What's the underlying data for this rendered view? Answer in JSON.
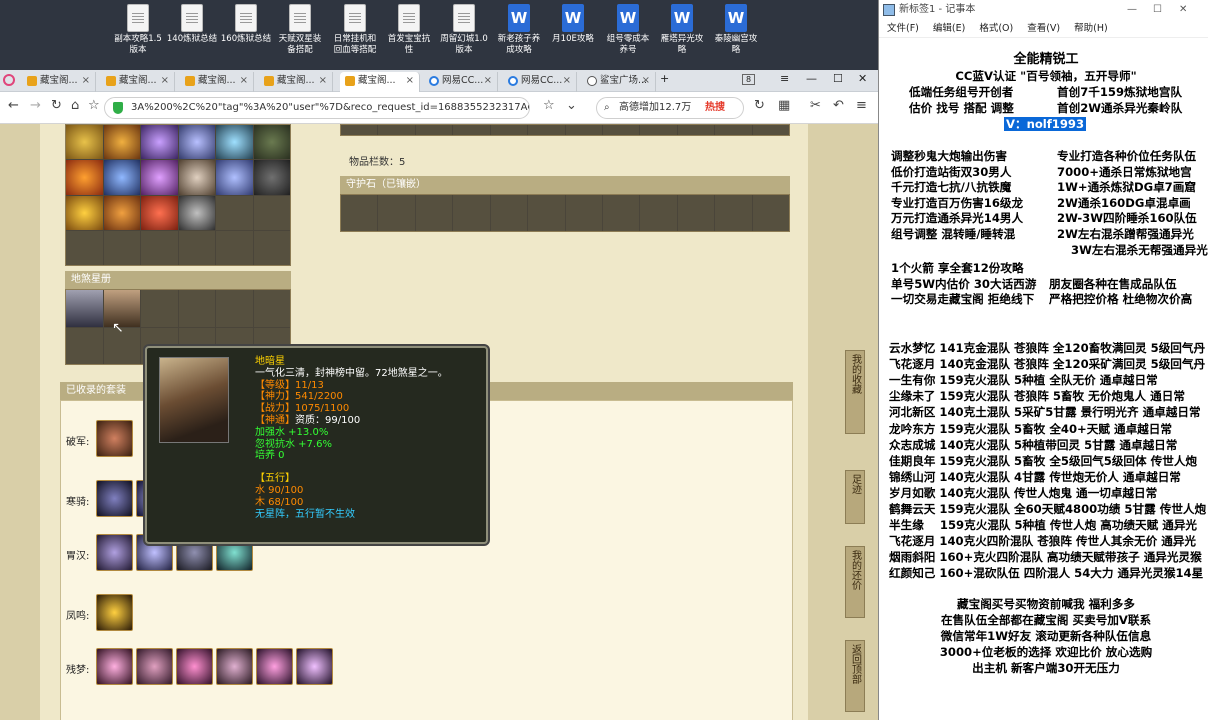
{
  "desktop_icons": [
    {
      "label": "副本攻略1.5\n版本",
      "type": "txt"
    },
    {
      "label": "140炼狱总结",
      "type": "txt"
    },
    {
      "label": "160炼狱总结",
      "type": "txt"
    },
    {
      "label": "天赋双星装\n备搭配",
      "type": "txt"
    },
    {
      "label": "日常挂机和\n回血等搭配",
      "type": "txt"
    },
    {
      "label": "首发宝宝抗\n性",
      "type": "txt"
    },
    {
      "label": "周留幻城1.0\n版本",
      "type": "txt"
    },
    {
      "label": "新老孩子养\n成攻略",
      "type": "word"
    },
    {
      "label": "月10E攻略",
      "type": "word"
    },
    {
      "label": "组号零成本\n养号",
      "type": "word"
    },
    {
      "label": "雁塔异光攻\n略",
      "type": "word"
    },
    {
      "label": "秦陵幽宫攻\n略",
      "type": "word"
    }
  ],
  "browser": {
    "tabs": [
      {
        "label": "藏宝阁..."
      },
      {
        "label": "藏宝阁..."
      },
      {
        "label": "藏宝阁..."
      },
      {
        "label": "藏宝阁..."
      },
      {
        "label": "藏宝阁..."
      },
      {
        "label": "网易CC..."
      },
      {
        "label": "网易CC..."
      },
      {
        "label": "鲨宝广场..."
      }
    ],
    "tab_count": "8",
    "address": "3A%200%2C%20\"tag\"%3A%20\"user\"%7D&reco_request_id=1688355232317AQq91",
    "search_text": "高德增加12.7万",
    "search_hot": "热搜"
  },
  "game": {
    "item_count": "物品栏数：5",
    "guardian_header": "守护石（已镶嵌）",
    "earth_header": "地煞星册",
    "collected_header": "已收录的套装",
    "sets": [
      {
        "name": "破军:"
      },
      {
        "name": "寒骑:"
      },
      {
        "name": "胃汉:"
      },
      {
        "name": "凤鸣:"
      },
      {
        "name": "残梦:"
      }
    ],
    "tooltip": {
      "name": "地暗星",
      "desc": "一气化三清，封神榜中留。72地煞星之一。",
      "level": "【等级】11/13",
      "divine": "【神力】541/2200",
      "battle": "【战力】1075/1100",
      "aptitude_label": "【神通】",
      "aptitude": "资质：99/100",
      "bonus1": "加强水 +13.0%",
      "bonus2": "忽视抗水 +7.6%",
      "train": "培养 0",
      "wuxing": "【五行】",
      "water": "水 90/100",
      "wood": "木 68/100",
      "note": "无星阵，五行暂不生效"
    },
    "side_buttons": [
      "我的收藏",
      "足迹",
      "我的还价",
      "返回顶部"
    ]
  },
  "notepad": {
    "title": "新标签1 - 记事本",
    "menu": [
      "文件(F)",
      "编辑(E)",
      "格式(O)",
      "查看(V)",
      "帮助(H)"
    ],
    "header": [
      "全能精锐工",
      "CC蓝V认证 \"百号领袖，五开导师\""
    ],
    "intro_left": [
      "低端任务组号开创者",
      "估价 找号 搭配 调整"
    ],
    "intro_right": [
      "首创7千159炼狱地宫队",
      "首创2W通杀异光秦岭队"
    ],
    "contact": "V：nolf1993",
    "services": [
      [
        "调整秒鬼大炮输出伤害",
        "专业打造各种价位任务队伍"
      ],
      [
        "低价打造站街双30男人",
        "7000+通杀日常炼狱地宫"
      ],
      [
        "千元打造七抗/八抗铁魔",
        "1W+通杀炼狱DG卓7画窟"
      ],
      [
        "专业打造百万伤害16级龙",
        "2W通杀160DG卓混卓画"
      ],
      [
        "万元打造通杀异光14男人",
        "2W-3W四阶睡杀160队伍"
      ],
      [
        "组号调整 混转睡/睡转混",
        "2W左右混杀蹭帮强通异光"
      ],
      [
        "",
        "3W左右混杀无帮强通异光"
      ]
    ],
    "promo": [
      [
        "1个火箭 享全套12份攻略",
        ""
      ],
      [
        "单号5W内估价 30大话西游",
        "朋友圈各种在售成品队伍"
      ],
      [
        "一切交易走藏宝阁 拒绝线下",
        "严格把控价格 杜绝物次价高"
      ]
    ],
    "teams": [
      "云水梦忆 141克金混队 苍狼阵 全120畜牧满回灵 5级回气丹",
      "飞花逐月 140克金混队 苍狼阵 全120采矿满回灵 5级回气丹",
      "一生有你 159克火混队 5种植 全队无价 通卓越日常",
      "尘缘未了 159克火混队 苍狼阵 5畜牧 无价炮鬼人 通日常",
      "河北新区 140克土混队 5采矿5甘露 景行明光齐 通卓越日常",
      "龙吟东方 159克火混队 5畜牧 全40+天赋 通卓越日常",
      "众志成城 140克火混队 5种植带回灵 5甘露 通卓越日常",
      "佳期良年 159克火混队 5畜牧 全5级回气5级回体 传世人炮",
      "锦绣山河 140克火混队 4甘露 传世炮无价人 通卓越日常",
      "岁月如歌 140克火混队 传世人炮鬼 通一切卓越日常",
      "鹤舞云天 159克火混队 全60天赋4800功绩 5甘露 传世人炮",
      "半生缘    159克火混队 5种植 传世人炮 高功绩天赋 通异光",
      "飞花逐月 140克火四阶混队 苍狼阵 传世人其余无价 通异光",
      "烟雨斜阳 160+克火四阶混队 高功绩天赋带孩子 通异光灵猴",
      "红颜知己 160+混砍队伍 四阶混人 54大力 通异光灵猴14星"
    ],
    "footer": [
      "藏宝阁买号买物资前喊我 福利多多",
      "在售队伍全部都在藏宝阁 买卖号加V联系",
      "微信常年1W好友 滚动更新各种队伍信息",
      "3000+位老板的选择 欢迎比价 放心选购",
      "出主机 新客户端30开无压力"
    ]
  }
}
